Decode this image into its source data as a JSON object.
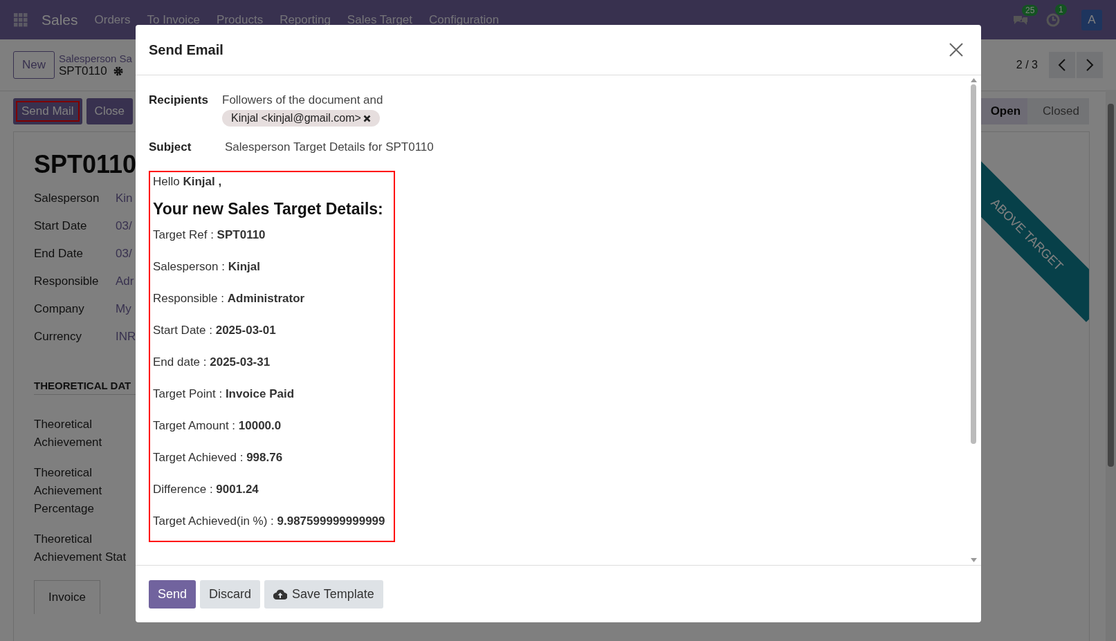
{
  "navbar": {
    "app": "Sales",
    "menu": [
      "Orders",
      "To Invoice",
      "Products",
      "Reporting",
      "Sales Target",
      "Configuration"
    ],
    "messages_count": "25",
    "activities_count": "1",
    "avatar": "A"
  },
  "control_panel": {
    "new_button": "New",
    "breadcrumb": "Salesperson Sa",
    "record": "SPT0110",
    "pager": "2 / 3"
  },
  "actions": [
    {
      "label": "Send Mail",
      "highlighted": true
    },
    {
      "label": "Close",
      "highlighted": false
    }
  ],
  "stages": [
    {
      "label": "Open",
      "selected": true
    },
    {
      "label": "Closed",
      "selected": false
    }
  ],
  "form": {
    "title": "SPT0110",
    "ribbon": "ABOVE TARGET",
    "fields": [
      {
        "label": "Salesperson",
        "value": "Kin"
      },
      {
        "label": "Start Date",
        "value": "03/"
      },
      {
        "label": "End Date",
        "value": "03/"
      },
      {
        "label": "Responsible",
        "value": "Adr"
      },
      {
        "label": "Company",
        "value": "My"
      },
      {
        "label": "Currency",
        "value": "INR"
      }
    ],
    "section": "THEORETICAL DAT",
    "theoretical_fields": [
      "Theoretical Achievement",
      "Theoretical Achievement Percentage",
      "Theoretical Achievement Stat"
    ],
    "tab": "Invoice"
  },
  "dialog": {
    "title": "Send Email",
    "recipients_label": "Recipients",
    "recipients_text": "Followers of the document and",
    "recipient_tags": [
      "Kinjal <kinjal@gmail.com>"
    ],
    "subject_label": "Subject",
    "subject": "Salesperson  Target Details for SPT0110",
    "body": {
      "greeting": "Hello **Kinjal ,**",
      "heading": "Your new Sales Target Details:",
      "lines": [
        "Target Ref : **SPT0110**",
        "Salesperson : **Kinjal**",
        "Responsible : **Administrator**",
        "Start Date : **2025-03-01**",
        "End date : **2025-03-31**",
        "Target Point : **Invoice Paid**",
        "Target Amount : **10000.0**",
        "Target Achieved : **998.76**",
        "Difference : **9001.24**",
        "Target Achieved(in %) : **9.987599999999999**"
      ]
    },
    "buttons": [
      {
        "label": "Send",
        "kind": "primary"
      },
      {
        "label": "Discard",
        "kind": "secondary"
      },
      {
        "label": "Save Template",
        "kind": "upload"
      }
    ]
  }
}
